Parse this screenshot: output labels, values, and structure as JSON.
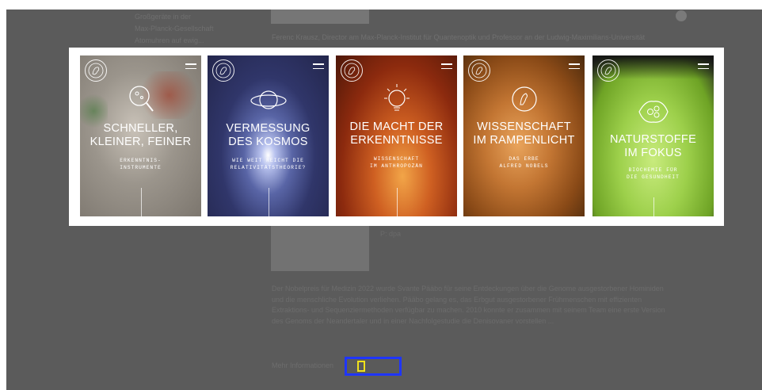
{
  "background": {
    "sidebar_lines": [
      "Großgeräte in der",
      "Max-Planck-Gesellschaft",
      "Atomuhren auf ewig..."
    ],
    "lead": "Ferenc Krausz, Director am Max-Planck-Institut für Quantenoptik und Professor an der Ludwig-Maximilians-Universität",
    "caption": "P: dpa",
    "paragraph": "Der Nobelpreis für Medizin 2022 wurde Svante Pääbo für seine Entdeckungen über die Genome ausgestorbener Hominiden und die menschliche Evolution verliehen. Pääbo gelang es, das Erbgut ausgestorbener Frühmenschen mit effizienten Extraktions- und Sequenziermethoden verfügbar zu machen. 2010 konnte er zusammen mit seinem Team eine erste Version des Genoms der Neandertaler und in einer Nachfolgestudie die Denisovaner vorstellen ...",
    "more": "Mehr Informationen"
  },
  "gallery": {
    "cards": [
      {
        "title_line1": "SCHNELLER,",
        "title_line2": "KLEINER, FEINER",
        "sub_line1": "ERKENNTNIS-",
        "sub_line2": "INSTRUMENTE",
        "icon": "magnifier-icon"
      },
      {
        "title_line1": "VERMESSUNG",
        "title_line2": "DES KOSMOS",
        "sub_line1": "WIE WEIT REICHT DIE",
        "sub_line2": "RELATIVITÄTSTHEORIE?",
        "icon": "planet-icon"
      },
      {
        "title_line1": "DIE MACHT DER",
        "title_line2": "ERKENNTNISSE",
        "sub_line1": "WISSENSCHAFT",
        "sub_line2": "IM ANTHROPOZÄN",
        "icon": "lightbulb-icon"
      },
      {
        "title_line1": "WISSENSCHAFT",
        "title_line2": "IM RAMPENLICHT",
        "sub_line1": "DAS ERBE",
        "sub_line2": "ALFRED NOBELS",
        "icon": "medal-icon"
      },
      {
        "title_line1": "NATURSTOFFE",
        "title_line2": "IM FOKUS",
        "sub_line1": "BIOCHEMIE FÜR",
        "sub_line2": "DIE GESUNDHEIT",
        "icon": "molecule-icon"
      }
    ]
  },
  "colors": {
    "focus_outer": "#1f35ff",
    "focus_inner": "#f1e21a",
    "overlay": "#5b5b5b"
  }
}
